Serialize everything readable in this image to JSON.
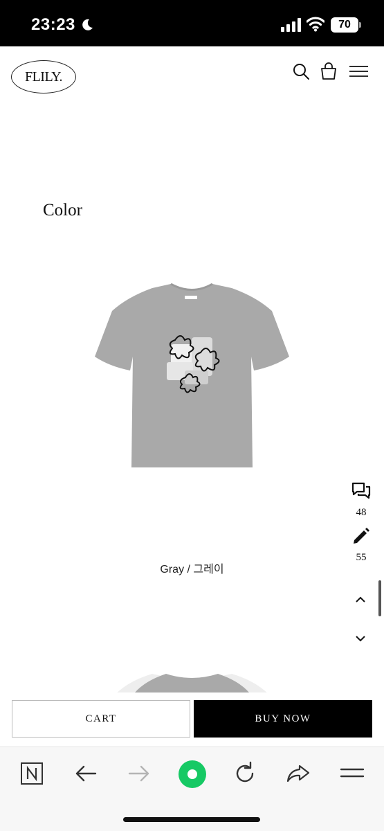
{
  "status_bar": {
    "time": "23:23",
    "battery": "70"
  },
  "header": {
    "logo_text": "FLILY."
  },
  "section": {
    "title": "Color"
  },
  "product": {
    "color_label": "Gray / 그레이"
  },
  "side_tools": {
    "qna_count": "48",
    "review_count": "55"
  },
  "actions": {
    "cart_label": "CART",
    "buy_label": "BUY NOW"
  },
  "browser_toolbar": {
    "items": [
      "n-icon",
      "back-icon",
      "forward-icon",
      "home-icon",
      "reload-icon",
      "share-icon",
      "menu-icon"
    ]
  },
  "colors": {
    "accent_green": "#16c964",
    "buy_background": "#000000",
    "shirt_gray": "#a9a9a9"
  }
}
